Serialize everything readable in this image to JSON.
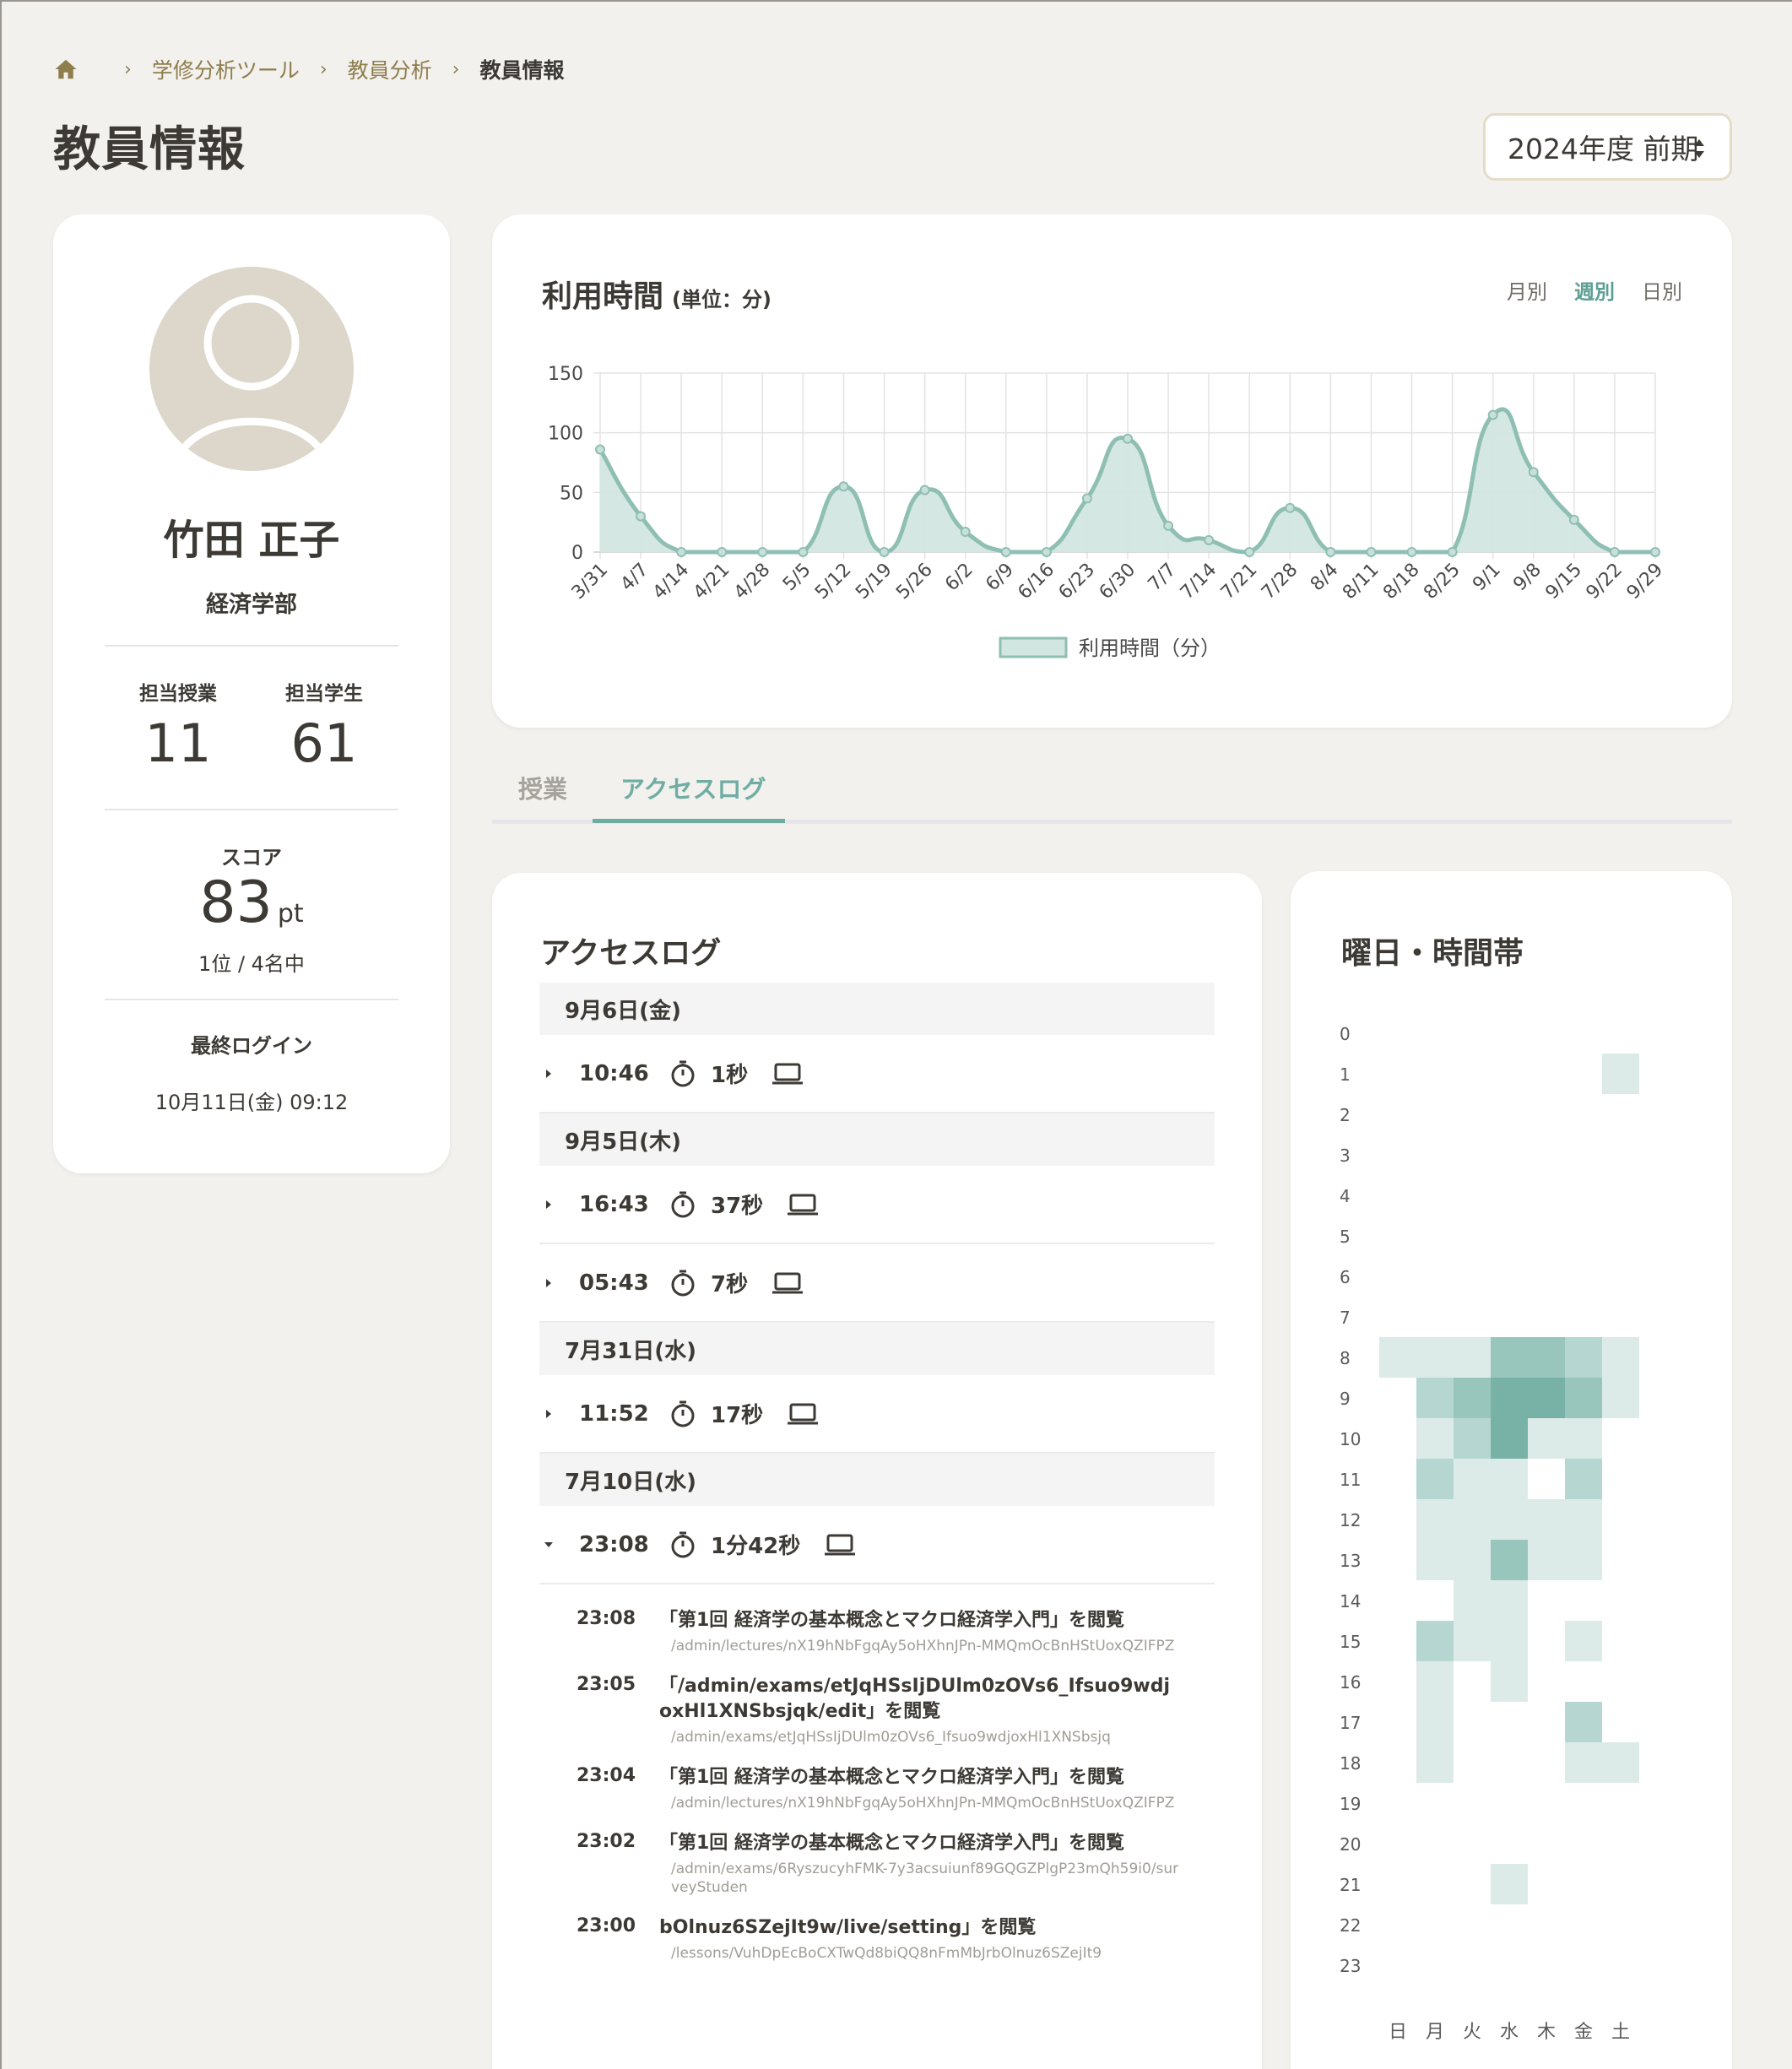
{
  "breadcrumb": {
    "items": [
      "学修分析ツール",
      "教員分析"
    ],
    "current": "教員情報"
  },
  "page_title": "教員情報",
  "term_select": {
    "value": "2024年度 前期"
  },
  "profile": {
    "name": "竹田 正子",
    "department": "経済学部",
    "classes_label": "担当授業",
    "classes_value": "11",
    "students_label": "担当学生",
    "students_value": "61",
    "score_label": "スコア",
    "score_value": "83",
    "score_unit": "pt",
    "rank": "1位 / 4名中",
    "last_login_label": "最終ログイン",
    "last_login_value": "10月11日(金) 09:12"
  },
  "usage": {
    "title": "利用時間",
    "unit": "(単位：分)",
    "period_tabs": [
      "月別",
      "週別",
      "日別"
    ],
    "active_period": "週別"
  },
  "chart_data": {
    "type": "area",
    "categories": [
      "3/31",
      "4/7",
      "4/14",
      "4/21",
      "4/28",
      "5/5",
      "5/12",
      "5/19",
      "5/26",
      "6/2",
      "6/9",
      "6/16",
      "6/23",
      "6/30",
      "7/7",
      "7/14",
      "7/21",
      "7/28",
      "8/4",
      "8/11",
      "8/18",
      "8/25",
      "9/1",
      "9/8",
      "9/15",
      "9/22",
      "9/29"
    ],
    "series": [
      {
        "name": "利用時間（分）",
        "values": [
          86,
          30,
          0,
          0,
          0,
          0,
          55,
          0,
          52,
          17,
          0,
          0,
          45,
          95,
          22,
          10,
          0,
          37,
          0,
          0,
          0,
          0,
          115,
          67,
          27,
          0,
          0
        ]
      }
    ],
    "yticks": [
      "0",
      "50",
      "100",
      "150"
    ],
    "ylim": [
      0,
      150
    ],
    "grid": true,
    "legend": "bottom",
    "color": "#8fbfb3"
  },
  "tabs": [
    {
      "label": "授業",
      "active": false
    },
    {
      "label": "アクセスログ",
      "active": true
    }
  ],
  "access_log": {
    "title": "アクセスログ",
    "groups": [
      {
        "date": "9月6日(金)",
        "sessions": [
          {
            "time": "10:46",
            "duration": "1秒"
          }
        ]
      },
      {
        "date": "9月5日(木)",
        "sessions": [
          {
            "time": "16:43",
            "duration": "37秒"
          },
          {
            "time": "05:43",
            "duration": "7秒"
          }
        ]
      },
      {
        "date": "7月31日(水)",
        "sessions": [
          {
            "time": "11:52",
            "duration": "17秒"
          }
        ]
      },
      {
        "date": "7月10日(水)",
        "sessions": [
          {
            "time": "23:08",
            "duration": "1分42秒"
          }
        ]
      }
    ],
    "details": [
      {
        "time": "23:08",
        "title": "「第1回 経済学の基本概念とマクロ経済学入門」を閲覧",
        "path": "/admin/lectures/nX19hNbFgqAy5oHXhnJPn-MMQmOcBnHStUoxQZIFPZ"
      },
      {
        "time": "23:05",
        "title": "「/admin/exams/etJqHSsIjDUlm0zOVs6_Ifsuo9wdjoxHl1XNSbsjqk/edit」を閲覧",
        "path": "/admin/exams/etJqHSsIjDUlm0zOVs6_Ifsuo9wdjoxHl1XNSbsjq"
      },
      {
        "time": "23:04",
        "title": "「第1回 経済学の基本概念とマクロ経済学入門」を閲覧",
        "path": "/admin/lectures/nX19hNbFgqAy5oHXhnJPn-MMQmOcBnHStUoxQZIFPZ"
      },
      {
        "time": "23:02",
        "title": "「第1回 経済学の基本概念とマクロ経済学入門」を閲覧",
        "path": "/admin/exams/6RyszucyhFMK-7y3acsuiunf89GQGZPlgP23mQh59i0/surveyStuden"
      },
      {
        "time": "23:00",
        "title": "bOlnuz6SZejIt9w/live/setting」を閲覧",
        "path": "/lessons/VuhDpEcBoCXTwQd8biQQ8nFmMbJrbOlnuz6SZejIt9"
      }
    ]
  },
  "heatmap": {
    "title": "曜日・時間帯",
    "days": [
      "日",
      "月",
      "火",
      "水",
      "木",
      "金",
      "土"
    ],
    "hours": [
      "0",
      "1",
      "2",
      "3",
      "4",
      "5",
      "6",
      "7",
      "8",
      "9",
      "10",
      "11",
      "12",
      "13",
      "14",
      "15",
      "16",
      "17",
      "18",
      "19",
      "20",
      "21",
      "22",
      "23"
    ],
    "colors": [
      "#ffffff",
      "#dcebe8",
      "#b6d7d1",
      "#98c6bd",
      "#78b2a7"
    ],
    "cells": [
      [
        0,
        0,
        0,
        0,
        0,
        0,
        0
      ],
      [
        0,
        0,
        0,
        0,
        0,
        0,
        1
      ],
      [
        0,
        0,
        0,
        0,
        0,
        0,
        0
      ],
      [
        0,
        0,
        0,
        0,
        0,
        0,
        0
      ],
      [
        0,
        0,
        0,
        0,
        0,
        0,
        0
      ],
      [
        0,
        0,
        0,
        0,
        0,
        0,
        0
      ],
      [
        0,
        0,
        0,
        0,
        0,
        0,
        0
      ],
      [
        0,
        0,
        0,
        0,
        0,
        0,
        0
      ],
      [
        1,
        1,
        1,
        3,
        3,
        2,
        1
      ],
      [
        0,
        2,
        3,
        4,
        4,
        3,
        1
      ],
      [
        0,
        1,
        2,
        4,
        1,
        1,
        0
      ],
      [
        0,
        2,
        1,
        1,
        0,
        2,
        0
      ],
      [
        0,
        1,
        1,
        1,
        1,
        1,
        0
      ],
      [
        0,
        1,
        1,
        3,
        1,
        1,
        0
      ],
      [
        0,
        0,
        1,
        1,
        0,
        0,
        0
      ],
      [
        0,
        2,
        1,
        1,
        0,
        1,
        0
      ],
      [
        0,
        1,
        0,
        1,
        0,
        0,
        0
      ],
      [
        0,
        1,
        0,
        0,
        0,
        2,
        0
      ],
      [
        0,
        1,
        0,
        0,
        0,
        1,
        1
      ],
      [
        0,
        0,
        0,
        0,
        0,
        0,
        0
      ],
      [
        0,
        0,
        0,
        0,
        0,
        0,
        0
      ],
      [
        0,
        0,
        0,
        1,
        0,
        0,
        0
      ],
      [
        0,
        0,
        0,
        0,
        0,
        0,
        0
      ],
      [
        0,
        0,
        0,
        0,
        0,
        0,
        0
      ]
    ]
  }
}
